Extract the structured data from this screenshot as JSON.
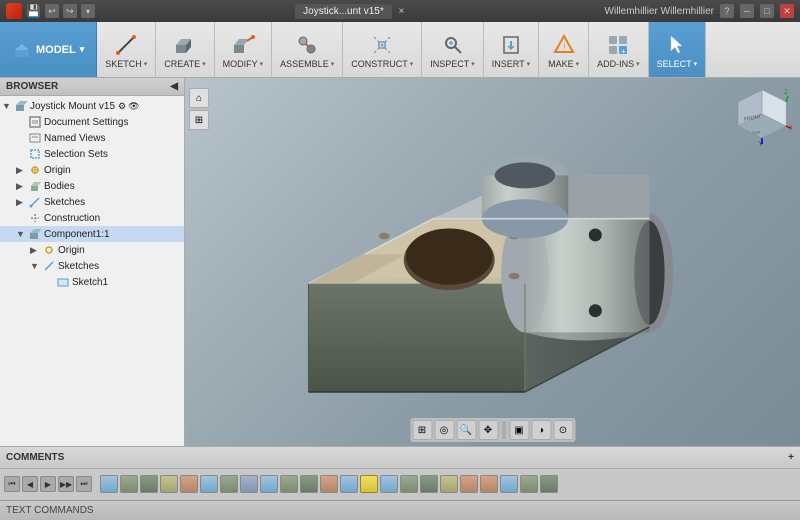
{
  "titleBar": {
    "leftIcons": [
      "save",
      "undo",
      "redo"
    ],
    "title": "Joystick...unt v15*",
    "tabLabel": "Joystick...unt v15*",
    "closeTabLabel": "×",
    "rightUser": "Willemhillier Willemhillier",
    "helpIcon": "?",
    "windowControls": [
      "minimize",
      "maximize",
      "close"
    ]
  },
  "toolbar": {
    "modelLabel": "MODEL",
    "modelArrow": "▾",
    "sections": [
      {
        "id": "sketch",
        "label": "SKETCH",
        "arrow": "▾"
      },
      {
        "id": "create",
        "label": "CREATE",
        "arrow": "▾"
      },
      {
        "id": "modify",
        "label": "MODIFY",
        "arrow": "▾"
      },
      {
        "id": "assemble",
        "label": "ASSEMBLE",
        "arrow": "▾"
      },
      {
        "id": "construct",
        "label": "CONSTRUCT",
        "arrow": "▾"
      },
      {
        "id": "inspect",
        "label": "INSPECT",
        "arrow": "▾"
      },
      {
        "id": "insert",
        "label": "INSERT",
        "arrow": "▾"
      },
      {
        "id": "make",
        "label": "MAKE",
        "arrow": "▾"
      },
      {
        "id": "addins",
        "label": "ADD-INS",
        "arrow": "▾"
      },
      {
        "id": "select",
        "label": "SELECT",
        "arrow": "▾"
      }
    ]
  },
  "browser": {
    "title": "BROWSER",
    "expandIcon": "◀",
    "items": [
      {
        "id": "root",
        "label": "Joystick Mount v15",
        "depth": 0,
        "toggle": "▼",
        "icon": "component"
      },
      {
        "id": "doc-settings",
        "label": "Document Settings",
        "depth": 1,
        "toggle": " ",
        "icon": "settings"
      },
      {
        "id": "named-views",
        "label": "Named Views",
        "depth": 1,
        "toggle": " ",
        "icon": "views"
      },
      {
        "id": "selection-sets",
        "label": "Selection Sets",
        "depth": 1,
        "toggle": " ",
        "icon": "sets"
      },
      {
        "id": "origin",
        "label": "Origin",
        "depth": 1,
        "toggle": "▶",
        "icon": "origin"
      },
      {
        "id": "bodies",
        "label": "Bodies",
        "depth": 1,
        "toggle": "▶",
        "icon": "bodies"
      },
      {
        "id": "sketches",
        "label": "Sketches",
        "depth": 1,
        "toggle": "▶",
        "icon": "sketches"
      },
      {
        "id": "construction",
        "label": "Construction",
        "depth": 1,
        "toggle": " ",
        "icon": "construction"
      },
      {
        "id": "component1",
        "label": "Component1:1",
        "depth": 1,
        "toggle": "▼",
        "icon": "component"
      },
      {
        "id": "comp-origin",
        "label": "Origin",
        "depth": 2,
        "toggle": "▶",
        "icon": "origin"
      },
      {
        "id": "comp-sketches",
        "label": "Sketches",
        "depth": 2,
        "toggle": "▼",
        "icon": "sketches"
      },
      {
        "id": "sketch1",
        "label": "Sketch1",
        "depth": 3,
        "toggle": " ",
        "icon": "sketch"
      }
    ]
  },
  "viewport": {
    "navCube": {
      "frontLabel": "FRONT",
      "topLabel": "TOP",
      "rightLabel": "RIGHT"
    }
  },
  "comments": {
    "title": "COMMENTS",
    "expandIcon": "+"
  },
  "timeline": {
    "playControls": [
      "⏮",
      "◀",
      "▶",
      "▶▶",
      "⏭"
    ],
    "features": [
      "sketch",
      "extrude",
      "fillet",
      "chamfer",
      "hole",
      "sketch",
      "extrude",
      "mirror",
      "sketch",
      "extrude",
      "fillet",
      "hole",
      "sketch",
      "extrude",
      "sketch",
      "extrude",
      "fillet",
      "chamfer",
      "hole",
      "hole",
      "sketch",
      "extrude",
      "fillet"
    ]
  },
  "textCommands": {
    "label": "TEXT COMMANDS"
  }
}
